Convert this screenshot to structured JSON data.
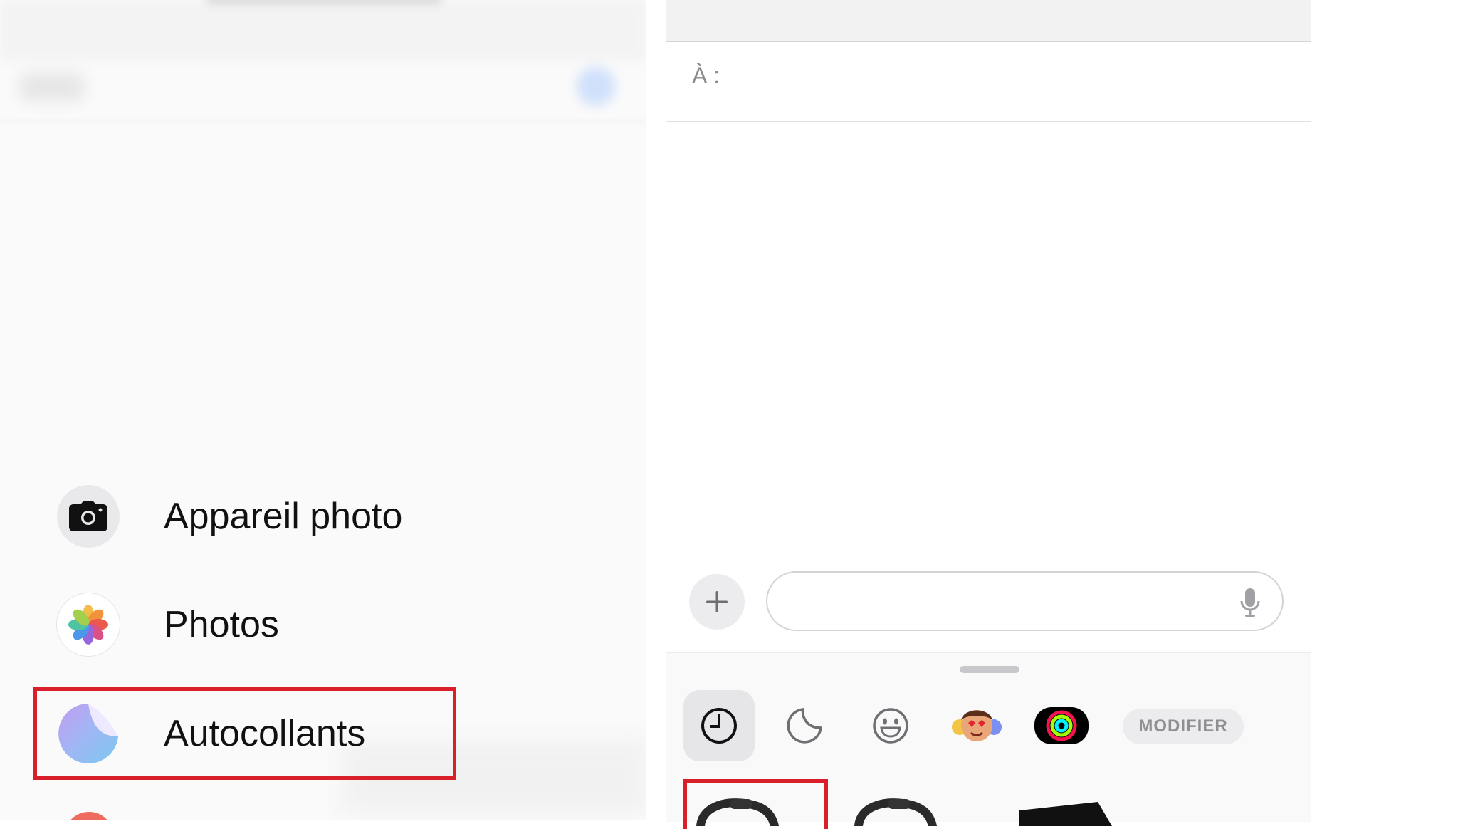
{
  "attachment_menu": {
    "items": [
      {
        "label": "Appareil photo",
        "icon": "camera-icon"
      },
      {
        "label": "Photos",
        "icon": "photos-icon"
      },
      {
        "label": "Autocollants",
        "icon": "stickers-icon",
        "highlighted": true
      }
    ]
  },
  "compose": {
    "to_label": "À :",
    "message_placeholder": ""
  },
  "drawer": {
    "tabs": [
      {
        "name": "recent",
        "icon": "clock-icon",
        "selected": true
      },
      {
        "name": "stickers",
        "icon": "sticker-icon"
      },
      {
        "name": "emoji",
        "icon": "smiley-icon"
      },
      {
        "name": "memoji",
        "icon": "memoji-icon"
      },
      {
        "name": "activity",
        "icon": "activity-rings-icon"
      }
    ],
    "edit_label": "MODIFIER"
  },
  "colors": {
    "highlight": "#d81f2a",
    "accent_blue": "#0a84ff"
  }
}
